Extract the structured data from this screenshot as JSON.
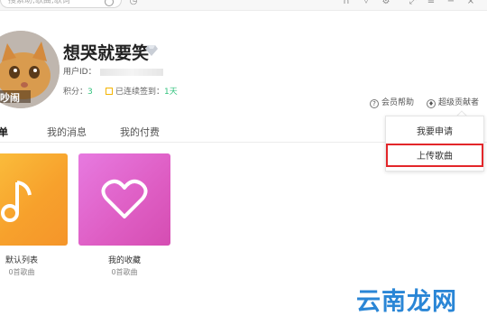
{
  "topbar": {
    "search_placeholder": "搜索助,歌曲,歌词"
  },
  "profile": {
    "username": "想哭就要笑",
    "userid_label": "用户ID：",
    "points_label": "积分：",
    "points_value": "3",
    "checkin_label": "已连续签到：",
    "checkin_value": "1天",
    "help_label": "会员帮助",
    "contrib_label": "超级贡献者",
    "avatar_text": "吵闹"
  },
  "tabs": [
    {
      "label": "歌单"
    },
    {
      "label": "我的消息"
    },
    {
      "label": "我的付费"
    }
  ],
  "cards": [
    {
      "title": "默认列表",
      "count": "0首歌曲"
    },
    {
      "title": "我的收藏",
      "count": "0首歌曲"
    }
  ],
  "dropdown": {
    "items": [
      {
        "label": "我要申请"
      },
      {
        "label": "上传歌曲"
      }
    ]
  },
  "watermark": "云南龙网",
  "colors": {
    "accent_green": "#31c27c",
    "highlight_red": "#e3262a",
    "watermark_blue": "#2a86d6"
  }
}
